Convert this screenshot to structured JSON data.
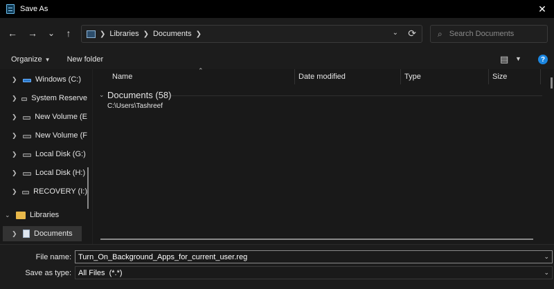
{
  "window": {
    "title": "Save As",
    "close_glyph": "✕",
    "icon": "notepad-icon"
  },
  "nav": {
    "back": "←",
    "forward": "→",
    "recent": "⌄",
    "up": "↑",
    "breadcrumb": [
      "Libraries",
      "Documents"
    ],
    "refresh": "⟳",
    "search_placeholder": "Search Documents"
  },
  "toolbar": {
    "organize": "Organize",
    "new_folder": "New folder",
    "help": "?"
  },
  "sidebar": {
    "items": [
      {
        "label": "Windows (C:)",
        "icon": "windows-drive-icon"
      },
      {
        "label": "System Reserve",
        "icon": "drive-icon"
      },
      {
        "label": "New Volume (E",
        "icon": "drive-icon"
      },
      {
        "label": "New Volume (F",
        "icon": "drive-icon"
      },
      {
        "label": "Local Disk (G:)",
        "icon": "drive-icon"
      },
      {
        "label": "Local Disk (H:)",
        "icon": "drive-icon"
      },
      {
        "label": "RECOVERY (I:)",
        "icon": "drive-icon"
      },
      {
        "label": "Libraries",
        "icon": "folder-icon"
      },
      {
        "label": "Documents",
        "icon": "documents-icon",
        "selected": true
      }
    ]
  },
  "columns": [
    "Name",
    "Date modified",
    "Type",
    "Size"
  ],
  "group": {
    "title": "Documents (58)",
    "path": "C:\\Users\\Tashreef"
  },
  "form": {
    "file_name_label": "File name:",
    "file_name_value": "Turn_On_Background_Apps_for_current_user.reg",
    "save_type_label": "Save as type:",
    "save_type_value": "All Files  (*.*)"
  },
  "colors": {
    "background": "#191919",
    "titlebar": "#000000",
    "accent": "#1b86e0"
  }
}
